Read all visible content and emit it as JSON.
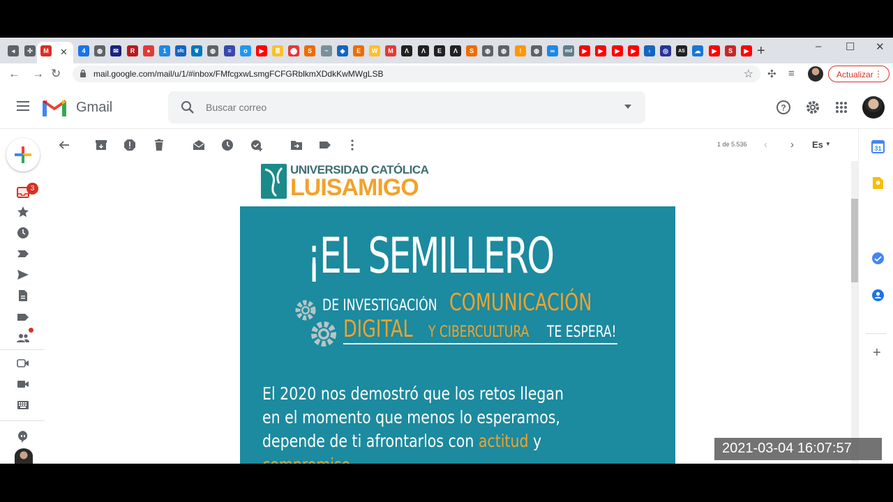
{
  "browser": {
    "url": "mail.google.com/mail/u/1/#inbox/FMfcgxwLsmgFCFGRblkmXDdkKwMWgLSB",
    "update_label": "Actualizar",
    "new_tab": "+",
    "tab_favicons": [
      {
        "icon": "speaker-icon",
        "color": "#5f6368",
        "glyph": "◂"
      },
      {
        "icon": "puzzle-icon",
        "color": "#5f6368",
        "glyph": "✣"
      },
      {
        "icon": "gmail-icon",
        "color": "#d93025",
        "glyph": "M"
      },
      {
        "icon": "calendar-icon",
        "color": "#1a73e8",
        "glyph": "4"
      },
      {
        "icon": "globe-icon",
        "color": "#5f6368",
        "glyph": "◍"
      },
      {
        "icon": "mail-icon",
        "color": "#1a237e",
        "glyph": "✉"
      },
      {
        "icon": "r-icon",
        "color": "#b71c1c",
        "glyph": "R"
      },
      {
        "icon": "red-circle-icon",
        "color": "#e53935",
        "glyph": "●"
      },
      {
        "icon": "blue-square-icon",
        "color": "#1e88e5",
        "glyph": "1"
      },
      {
        "icon": "sfc-icon",
        "color": "#1565c0",
        "glyph": "sfc"
      },
      {
        "icon": "leaf-icon",
        "color": "#0277bd",
        "glyph": "❦"
      },
      {
        "icon": "globe-icon",
        "color": "#5f6368",
        "glyph": "◍"
      },
      {
        "icon": "list-icon",
        "color": "#3949ab",
        "glyph": "≡"
      },
      {
        "icon": "ocm-icon",
        "color": "#2196f3",
        "glyph": "o"
      },
      {
        "icon": "youtube-icon",
        "color": "#ff0000",
        "glyph": "▶"
      },
      {
        "icon": "doc-icon",
        "color": "#fbc02d",
        "glyph": "≣"
      },
      {
        "icon": "pin-icon",
        "color": "#e53935",
        "glyph": "⬤"
      },
      {
        "icon": "sjr-icon",
        "color": "#ef6c00",
        "glyph": "S"
      },
      {
        "icon": "wave-icon",
        "color": "#78909c",
        "glyph": "~"
      },
      {
        "icon": "shield-icon",
        "color": "#1565c0",
        "glyph": "◈"
      },
      {
        "icon": "e-icon",
        "color": "#ef6c00",
        "glyph": "E"
      },
      {
        "icon": "w-icon",
        "color": "#fbc02d",
        "glyph": "W"
      },
      {
        "icon": "m-icon",
        "color": "#e53935",
        "glyph": "M"
      },
      {
        "icon": "lambda-icon",
        "color": "#212121",
        "glyph": "Λ"
      },
      {
        "icon": "lambda-icon",
        "color": "#212121",
        "glyph": "Λ"
      },
      {
        "icon": "e-bold-icon",
        "color": "#212121",
        "glyph": "E"
      },
      {
        "icon": "lambda-icon",
        "color": "#212121",
        "glyph": "Λ"
      },
      {
        "icon": "sjr-icon",
        "color": "#ef6c00",
        "glyph": "S"
      },
      {
        "icon": "globe-icon",
        "color": "#5f6368",
        "glyph": "◍"
      },
      {
        "icon": "globe-icon",
        "color": "#5f6368",
        "glyph": "◍"
      },
      {
        "icon": "orange-doc-icon",
        "color": "#ff9800",
        "glyph": "!"
      },
      {
        "icon": "globe-icon",
        "color": "#5f6368",
        "glyph": "◍"
      },
      {
        "icon": "link-icon",
        "color": "#1e88e5",
        "glyph": "∞"
      },
      {
        "icon": "md-icon",
        "color": "#607d8b",
        "glyph": "md"
      },
      {
        "icon": "youtube-icon",
        "color": "#ff0000",
        "glyph": "▶"
      },
      {
        "icon": "youtube-icon",
        "color": "#ff0000",
        "glyph": "▶"
      },
      {
        "icon": "youtube-icon",
        "color": "#ff0000",
        "glyph": "▶"
      },
      {
        "icon": "youtube-icon",
        "color": "#ff0000",
        "glyph": "▶"
      },
      {
        "icon": "tie-icon",
        "color": "#1565c0",
        "glyph": "♁"
      },
      {
        "icon": "target-icon",
        "color": "#283593",
        "glyph": "◎"
      },
      {
        "icon": "as-icon",
        "color": "#212121",
        "glyph": "AS"
      },
      {
        "icon": "cloud-icon",
        "color": "#1976d2",
        "glyph": "☁"
      },
      {
        "icon": "youtube-icon",
        "color": "#ff0000",
        "glyph": "▶"
      },
      {
        "icon": "s-icon",
        "color": "#c62828",
        "glyph": "S"
      },
      {
        "icon": "youtube-icon",
        "color": "#ff0000",
        "glyph": "▶"
      }
    ]
  },
  "gmail": {
    "brand": "Gmail",
    "search_placeholder": "Buscar correo",
    "inbox_count": "3",
    "counter": "1 de 5.536",
    "lang": "Es"
  },
  "email": {
    "university_top": "UNIVERSIDAD CATÓLICA",
    "university_bottom": "LUISAMIGO",
    "title": "¡EL SEMILLERO",
    "line1_a": "DE INVESTIGACIÓN",
    "line1_b": "COMUNICACIÓN",
    "line2_a": "DIGITAL",
    "line2_b": "Y CIBERCULTURA",
    "line2_c": "TE ESPERA!",
    "body_1": "El 2020 nos demostró que los retos llegan",
    "body_2": "en el momento que menos lo esperamos,",
    "body_3a": "depende de ti afrontarlos con ",
    "body_3b": "actitud",
    "body_3c": " y",
    "body_4": "compromiso"
  },
  "overlay": {
    "timestamp": "2021-03-04 16:07:57"
  },
  "colors": {
    "banner": "#1c8a9f",
    "accent": "#f2a22c",
    "gmail_red": "#d93025"
  }
}
